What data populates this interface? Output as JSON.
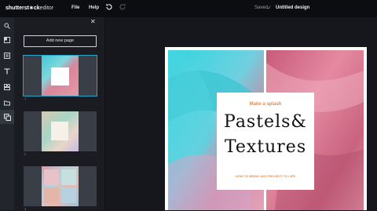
{
  "topbar": {
    "logo_main": "shutterst∗ck",
    "logo_light": "editor",
    "file": "File",
    "help": "Help",
    "saved": "Saved",
    "title": "Untitled design"
  },
  "panel": {
    "add_page": "Add new page",
    "close": "✕",
    "pages": [
      "1",
      "2",
      "3"
    ]
  },
  "design": {
    "tagline": "Make a splash",
    "title_line1": "Pastels&",
    "title_line2": "Textures",
    "subtitle": "HOW TO BRING ANY PROJECT TO LIFE"
  },
  "colors": {
    "accent": "#f08a3c",
    "selected_outline": "#2aa6c9"
  },
  "icons": {
    "undo": "undo-icon",
    "redo": "redo-icon",
    "saved": "check-icon",
    "sidebar": [
      "search-icon",
      "layout-icon",
      "template-icon",
      "text-icon",
      "elements-icon",
      "folder-icon",
      "pages-icon"
    ]
  }
}
